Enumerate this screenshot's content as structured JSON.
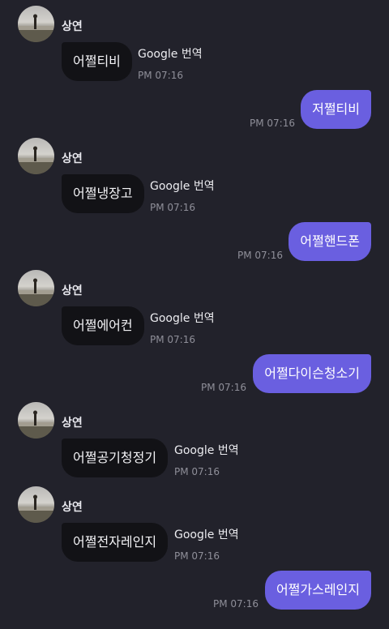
{
  "messages": [
    {
      "type": "in",
      "sender": "상연",
      "text": "어쩔티비",
      "translate": "Google 번역",
      "time": "PM 07:16"
    },
    {
      "type": "out",
      "text": "저쩔티비",
      "time": "PM 07:16"
    },
    {
      "type": "in",
      "sender": "상연",
      "text": "어쩔냉장고",
      "translate": "Google 번역",
      "time": "PM 07:16"
    },
    {
      "type": "out",
      "text": "어쩔핸드폰",
      "time": "PM 07:16"
    },
    {
      "type": "in",
      "sender": "상연",
      "text": "어쩔에어컨",
      "translate": "Google 번역",
      "time": "PM 07:16"
    },
    {
      "type": "out",
      "text": "어쩔다이슨청소기",
      "time": "PM 07:16"
    },
    {
      "type": "in",
      "sender": "상연",
      "text": "어쩔공기청정기",
      "translate": "Google 번역",
      "time": "PM 07:16"
    },
    {
      "type": "in",
      "sender": "상연",
      "text": "어쩔전자레인지",
      "translate": "Google 번역",
      "time": "PM 07:16"
    },
    {
      "type": "out",
      "text": "어쩔가스레인지",
      "time": "PM 07:16"
    }
  ],
  "colors": {
    "background": "#22222b",
    "incoming_bubble": "#121216",
    "outgoing_bubble": "#6a5fe0"
  }
}
